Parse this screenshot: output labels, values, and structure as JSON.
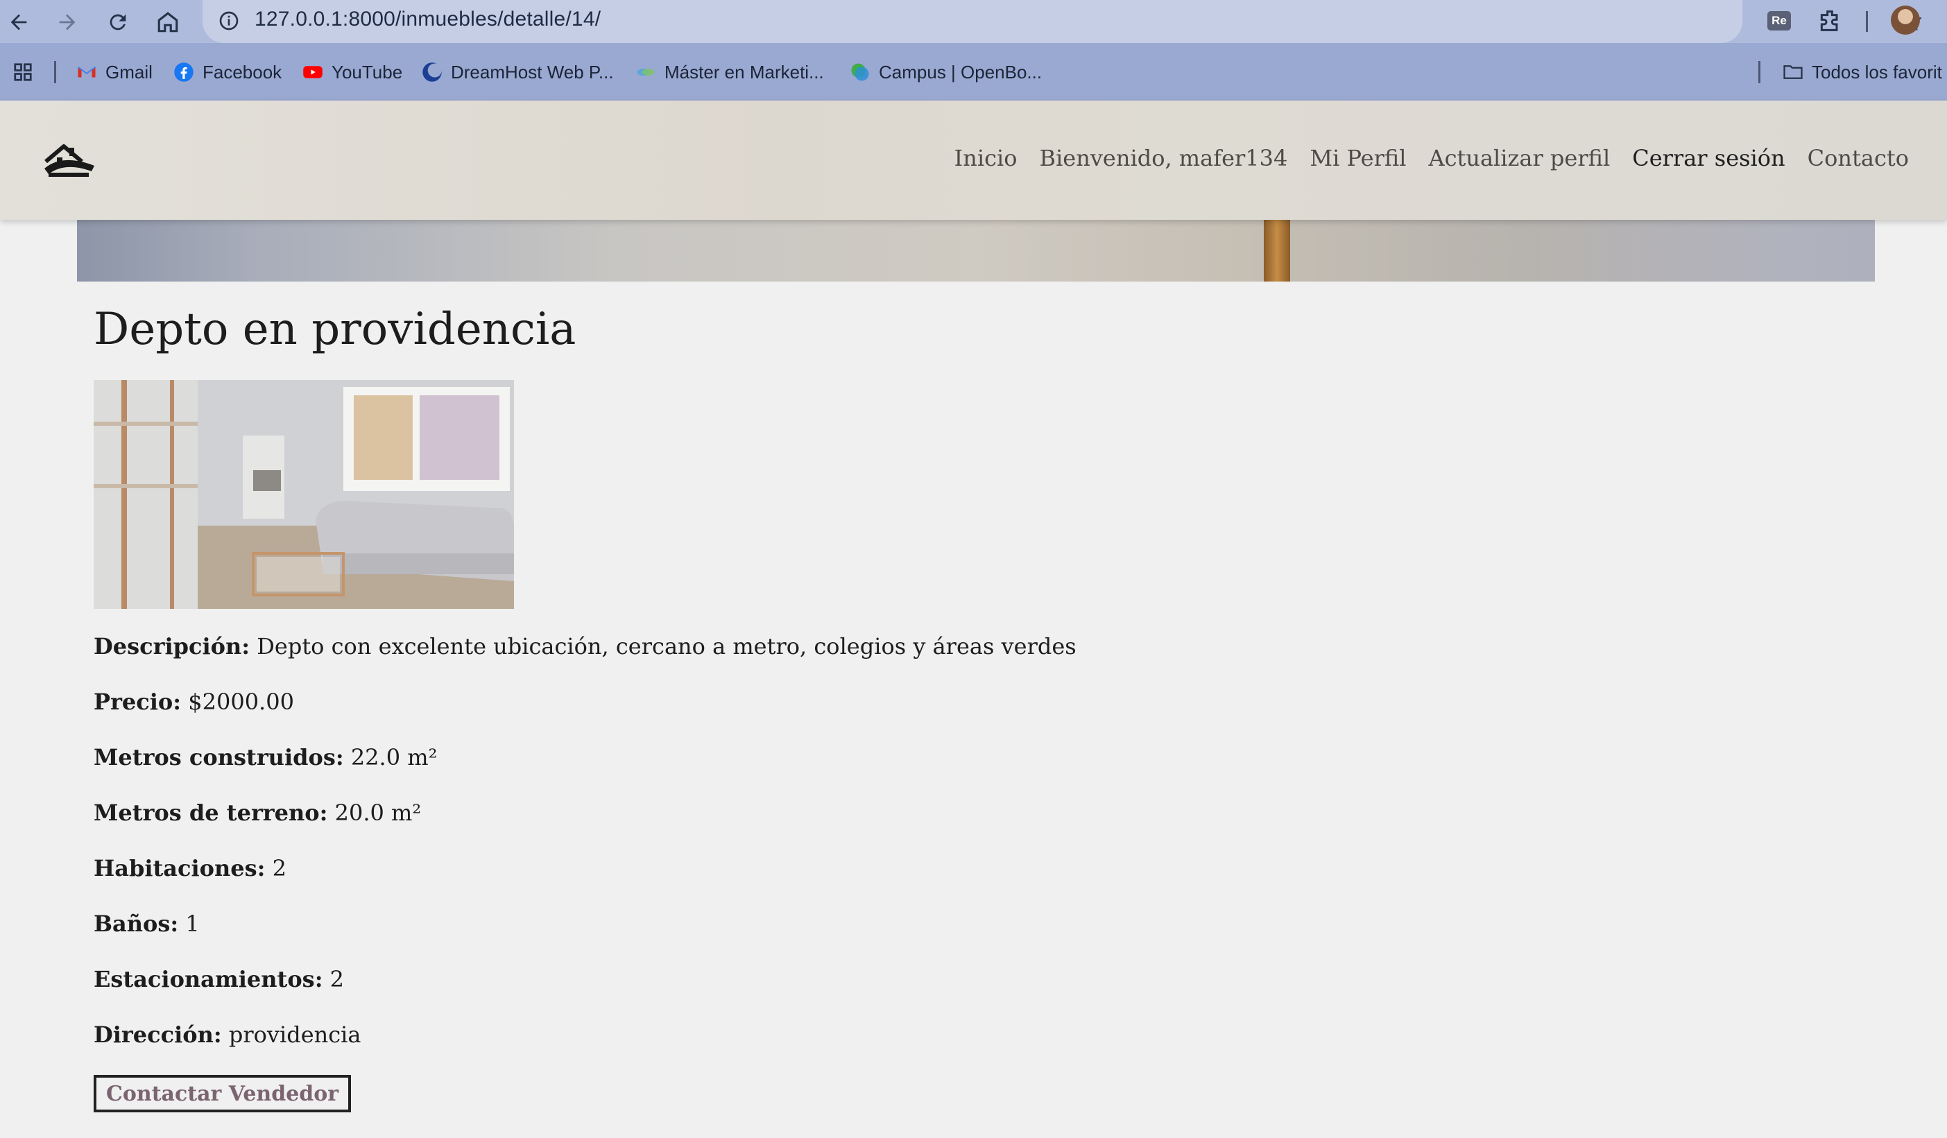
{
  "browser": {
    "url": "127.0.0.1:8000/inmuebles/detalle/14/",
    "extension_label": "Re",
    "bookmarks": [
      {
        "label": "Gmail",
        "icon": "gmail-icon"
      },
      {
        "label": "Facebook",
        "icon": "facebook-icon"
      },
      {
        "label": "YouTube",
        "icon": "youtube-icon"
      },
      {
        "label": "DreamHost Web P...",
        "icon": "dreamhost-icon"
      },
      {
        "label": "Máster en Marketi...",
        "icon": "marketing-icon"
      },
      {
        "label": "Campus | OpenBo...",
        "icon": "campus-icon"
      }
    ],
    "all_bookmarks_label": "Todos los favorit"
  },
  "header": {
    "nav": [
      "Inicio",
      "Bienvenido, mafer134",
      "Mi Perfil",
      "Actualizar perfil",
      "Cerrar sesión",
      "Contacto"
    ]
  },
  "property": {
    "title": "Depto en providencia",
    "fields": [
      {
        "label": "Descripción:",
        "value": "Depto con excelente ubicación, cercano a metro, colegios y áreas verdes"
      },
      {
        "label": "Precio:",
        "value": "$2000.00"
      },
      {
        "label": "Metros construidos:",
        "value": "22.0 m²"
      },
      {
        "label": "Metros de terreno:",
        "value": "20.0 m²"
      },
      {
        "label": "Habitaciones:",
        "value": "2"
      },
      {
        "label": "Baños:",
        "value": "1"
      },
      {
        "label": "Estacionamientos:",
        "value": "2"
      },
      {
        "label": "Dirección:",
        "value": "providencia"
      }
    ],
    "contact_button": "Contactar Vendedor"
  }
}
